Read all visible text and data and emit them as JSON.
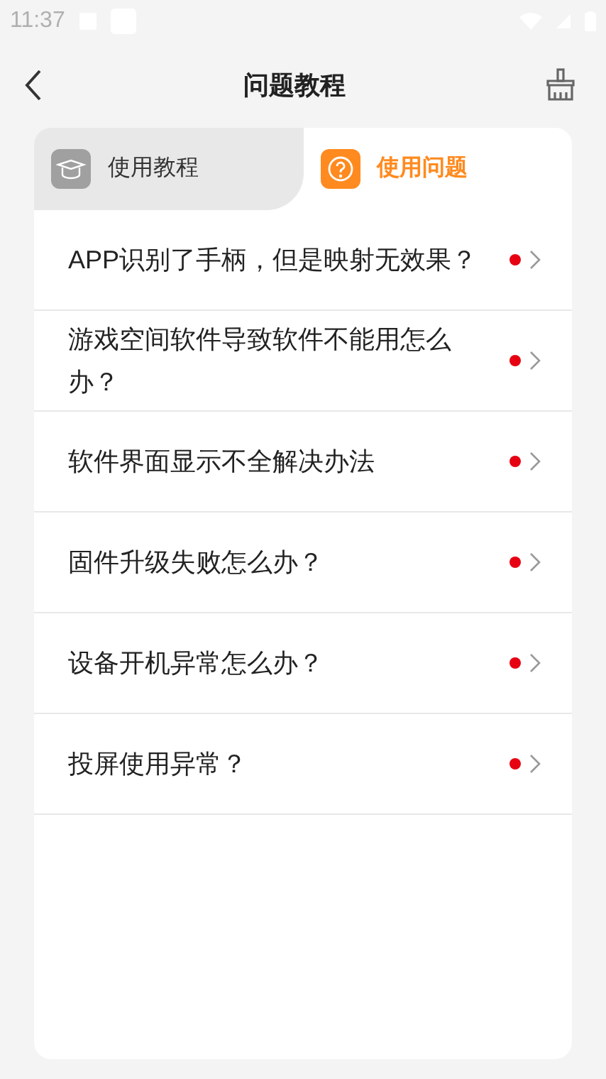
{
  "status_bar": {
    "time": "11:37"
  },
  "header": {
    "title": "问题教程"
  },
  "tabs": [
    {
      "label": "使用教程",
      "selected": false,
      "kind": "tutorial"
    },
    {
      "label": "使用问题",
      "selected": true,
      "kind": "question"
    }
  ],
  "questions": [
    {
      "text": "APP识别了手柄，但是映射无效果？",
      "unread": true
    },
    {
      "text": "游戏空间软件导致软件不能用怎么办？",
      "unread": true
    },
    {
      "text": "软件界面显示不全解决办法",
      "unread": true
    },
    {
      "text": "固件升级失败怎么办？",
      "unread": true
    },
    {
      "text": "设备开机异常怎么办？",
      "unread": true
    },
    {
      "text": "投屏使用异常？",
      "unread": true
    }
  ]
}
